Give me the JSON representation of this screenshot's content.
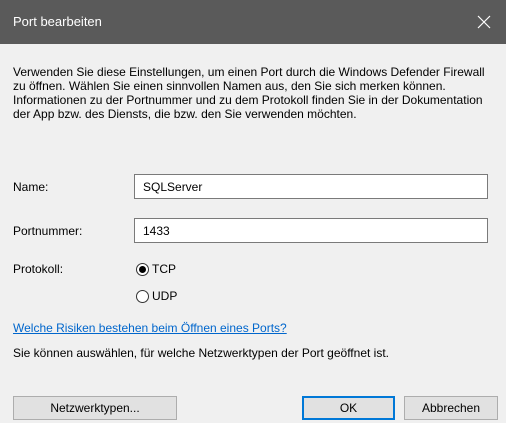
{
  "dialog": {
    "title": "Port bearbeiten",
    "description": "Verwenden Sie diese Einstellungen, um einen Port durch die Windows Defender Firewall zu öffnen. Wählen Sie einen sinnvollen Namen aus, den Sie sich merken können. Informationen zu der Portnummer und zu dem Protokoll finden Sie in der Dokumentation der App bzw. des Diensts, die bzw. den Sie verwenden möchten."
  },
  "form": {
    "name_label": "Name:",
    "name_value": "SQLServer",
    "port_label": "Portnummer:",
    "port_value": "1433",
    "protocol_label": "Protokoll:",
    "protocol_options": [
      "TCP",
      "UDP"
    ],
    "protocol_selected": "TCP"
  },
  "link_text": "Welche Risiken bestehen beim Öffnen eines Ports?",
  "info_text": "Sie können auswählen, für welche Netzwerktypen der Port geöffnet ist.",
  "buttons": {
    "network_types": "Netzwerktypen...",
    "ok": "OK",
    "cancel": "Abbrechen"
  },
  "icons": {
    "close": "close-icon",
    "radio": "radio-icon"
  },
  "colors": {
    "titlebar": "#5a5a5a",
    "link": "#0066cc",
    "dialog_bg": "#f0f0f0",
    "accent": "#0078d7"
  }
}
